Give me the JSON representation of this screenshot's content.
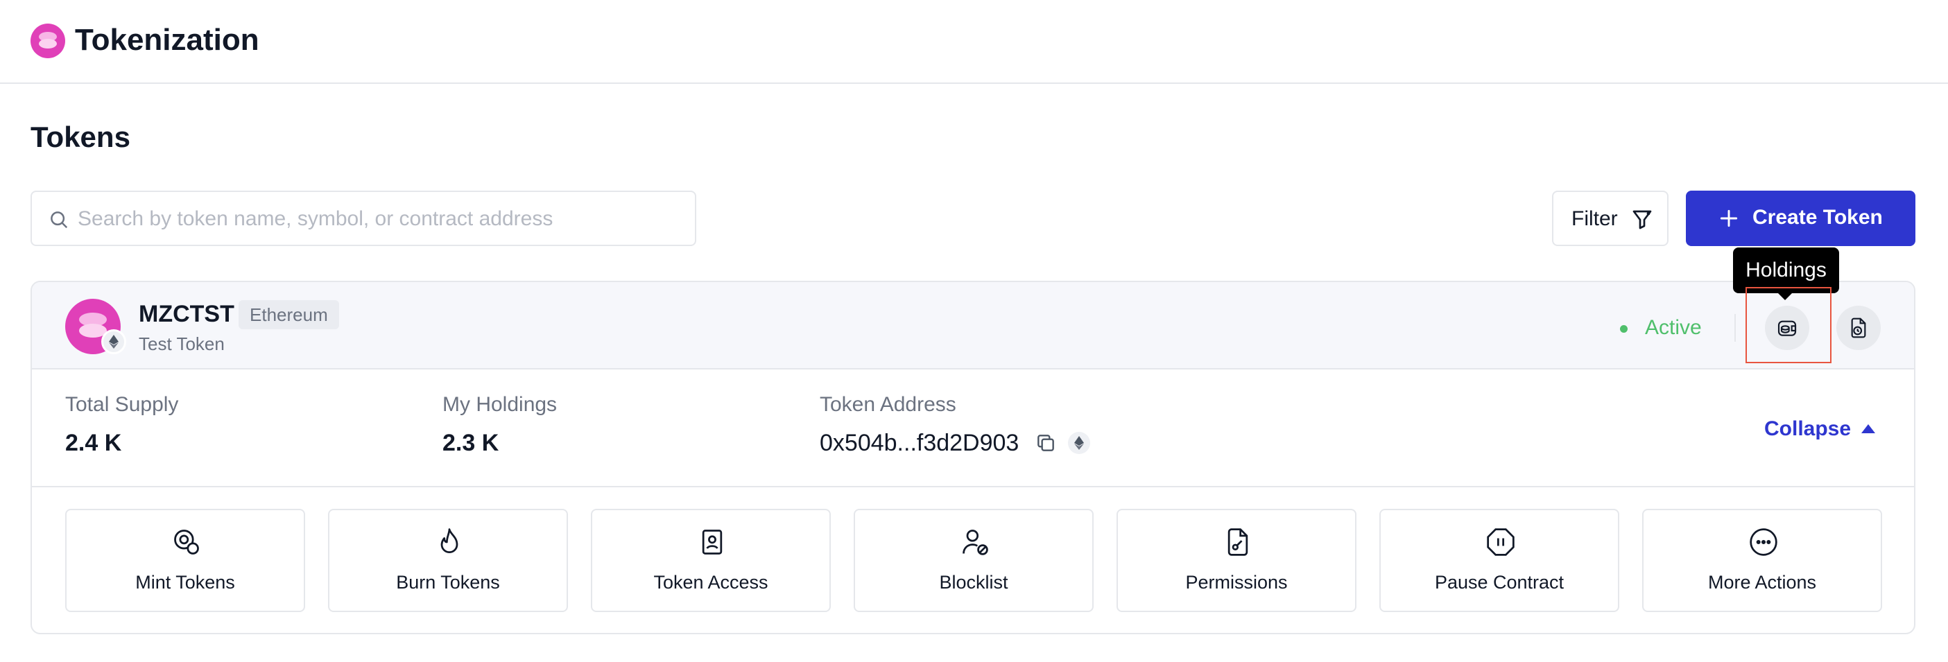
{
  "app": {
    "title": "Tokenization",
    "logo_icon": "token-logo-icon"
  },
  "page": {
    "title": "Tokens"
  },
  "search": {
    "placeholder": "Search by token name, symbol, or contract address",
    "value": ""
  },
  "toolbar": {
    "filter_label": "Filter",
    "create_label": "Create Token"
  },
  "token": {
    "symbol": "MZCTST",
    "chain": "Ethereum",
    "name": "Test Token",
    "status": "Active",
    "stats": {
      "total_supply_label": "Total Supply",
      "total_supply_value": "2.4 K",
      "my_holdings_label": "My Holdings",
      "my_holdings_value": "2.3 K",
      "address_label": "Token Address",
      "address_value": "0x504b...f3d2D903"
    },
    "collapse_label": "Collapse",
    "tooltip": "Holdings",
    "actions": [
      {
        "label": "Mint Tokens",
        "icon": "mint-icon"
      },
      {
        "label": "Burn Tokens",
        "icon": "flame-icon"
      },
      {
        "label": "Token Access",
        "icon": "contact-book-icon"
      },
      {
        "label": "Blocklist",
        "icon": "user-blocked-icon"
      },
      {
        "label": "Permissions",
        "icon": "document-key-icon"
      },
      {
        "label": "Pause Contract",
        "icon": "pause-octagon-icon"
      },
      {
        "label": "More Actions",
        "icon": "more-horizontal-icon"
      }
    ]
  },
  "colors": {
    "accent": "#2e36cf",
    "brand_pink": "#e040b8",
    "status_active": "#4fbf6b",
    "highlight_border": "#e8553f",
    "tooltip_bg": "#000000"
  }
}
